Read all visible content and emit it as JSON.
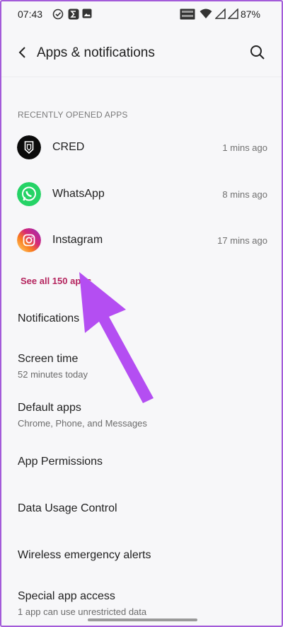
{
  "status_bar": {
    "time": "07:43",
    "battery": "87%"
  },
  "header": {
    "title": "Apps & notifications"
  },
  "recent": {
    "heading": "RECENTLY OPENED APPS",
    "apps": [
      {
        "name": "CRED",
        "time": "1 mins ago"
      },
      {
        "name": "WhatsApp",
        "time": "8 mins ago"
      },
      {
        "name": "Instagram",
        "time": "17 mins ago"
      }
    ],
    "see_all": "See all 150 apps"
  },
  "menu": [
    {
      "title": "Notifications",
      "subtitle": ""
    },
    {
      "title": "Screen time",
      "subtitle": "52 minutes today"
    },
    {
      "title": "Default apps",
      "subtitle": "Chrome, Phone, and Messages"
    },
    {
      "title": "App Permissions",
      "subtitle": ""
    },
    {
      "title": "Data Usage Control",
      "subtitle": ""
    },
    {
      "title": "Wireless emergency alerts",
      "subtitle": ""
    },
    {
      "title": "Special app access",
      "subtitle": "1 app can use unrestricted data"
    }
  ],
  "colors": {
    "accent": "#b5265f",
    "annotation_arrow": "#b44ef2",
    "whatsapp": "#25d366"
  }
}
